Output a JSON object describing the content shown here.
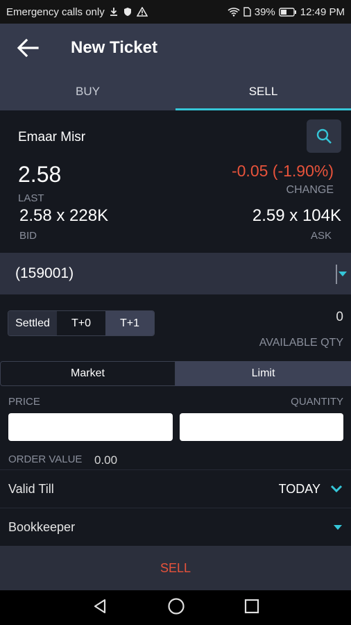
{
  "status_bar": {
    "carrier": "Emergency calls only",
    "battery": "39%",
    "time": "12:49 PM",
    "icons": [
      "download-icon",
      "shield-icon",
      "warning-icon",
      "wifi-icon",
      "sim-icon",
      "battery-icon"
    ]
  },
  "app_bar": {
    "title": "New Ticket",
    "back_icon": "arrow-left-icon"
  },
  "tabs": [
    {
      "label": "BUY",
      "active": false
    },
    {
      "label": "SELL",
      "active": true
    }
  ],
  "quote": {
    "company": "Emaar Misr",
    "last": "2.58",
    "last_label": "LAST",
    "change": "-0.05 (-1.90%)",
    "change_label": "CHANGE",
    "bid": "2.58 x 228K",
    "bid_label": "BID",
    "ask": "2.59 x 104K",
    "ask_label": "ASK",
    "search_icon": "search-icon"
  },
  "account": {
    "value": "(159001)"
  },
  "settlement": {
    "options": [
      "Settled",
      "T+0",
      "T+1"
    ],
    "selected": "T+1",
    "available_qty": "0",
    "available_qty_label": "AVAILABLE QTY"
  },
  "order_type": {
    "options": [
      "Market",
      "Limit"
    ],
    "selected": "Limit"
  },
  "form": {
    "price_label": "PRICE",
    "quantity_label": "QUANTITY",
    "price_value": "",
    "quantity_value": "",
    "order_value_label": "ORDER VALUE",
    "order_value": "0.00"
  },
  "valid_till": {
    "label": "Valid Till",
    "value": "TODAY"
  },
  "bookkeeper": {
    "label": "Bookkeeper"
  },
  "action": {
    "label": "SELL"
  },
  "colors": {
    "accent": "#35c6d8",
    "negative": "#e8533b",
    "header": "#353a4c",
    "background": "#15181f"
  }
}
